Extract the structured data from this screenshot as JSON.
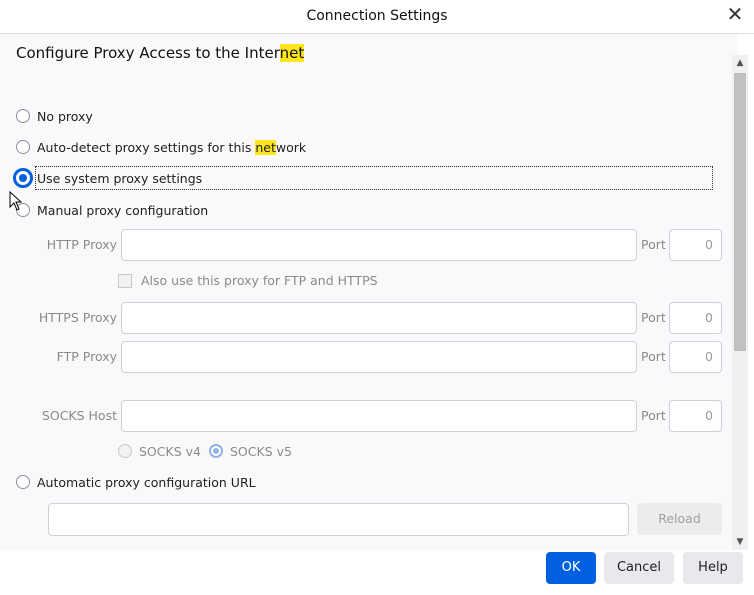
{
  "window": {
    "title": "Connection Settings",
    "close_glyph": "✕"
  },
  "heading": {
    "pre": "Configure Proxy Access to the Inter",
    "hl": "net"
  },
  "options": {
    "no_proxy": "No proxy",
    "auto_detect_pre": "Auto-detect proxy settings for this ",
    "auto_detect_hl": "net",
    "auto_detect_post": "work",
    "system": "Use system proxy settings",
    "manual": "Manual proxy configuration",
    "auto_url": "Automatic proxy configuration URL"
  },
  "manual": {
    "http_label": "HTTP Proxy",
    "https_label": "HTTPS Proxy",
    "ftp_label": "FTP Proxy",
    "socks_label": "SOCKS Host",
    "port_label": "Port",
    "http_port": "0",
    "https_port": "0",
    "ftp_port": "0",
    "socks_port": "0",
    "also_use": "Also use this proxy for FTP and HTTPS",
    "socks_v4": "SOCKS v4",
    "socks_v5": "SOCKS v5"
  },
  "auto_url": {
    "reload": "Reload"
  },
  "buttons": {
    "ok": "OK",
    "cancel": "Cancel",
    "help": "Help"
  },
  "selected": "system"
}
